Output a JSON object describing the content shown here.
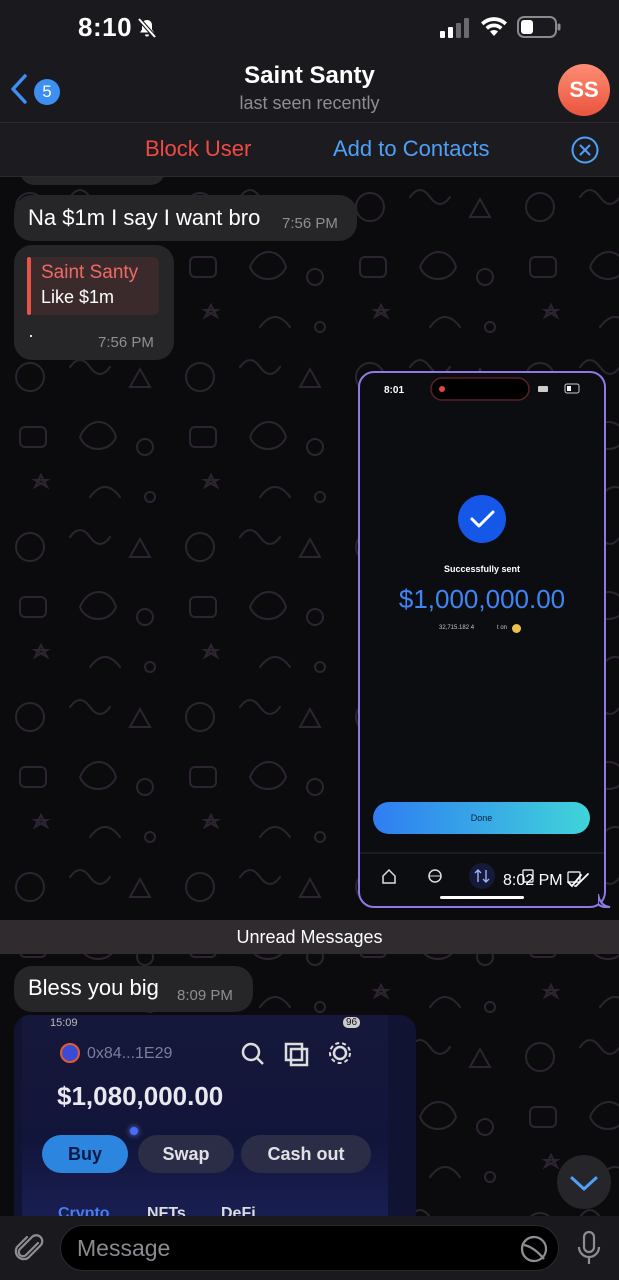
{
  "status_bar": {
    "time": "8:10",
    "icons": [
      "bell-slash-icon",
      "cellular-signal-icon",
      "wifi-icon",
      "battery-icon"
    ]
  },
  "header": {
    "back_badge_count": "5",
    "title": "Saint Santy",
    "subtitle": "last seen recently",
    "avatar_initials": "SS",
    "avatar_color": "#f06a50"
  },
  "action_bar": {
    "block_label": "Block User",
    "add_label": "Add to Contacts",
    "block_color": "#ef4a44",
    "add_color": "#4fa0f7"
  },
  "messages": [
    {
      "text": "Na $1m I say I want bro",
      "time": "7:56 PM"
    },
    {
      "reply_name": "Saint Santy",
      "reply_text": "Like $1m",
      "text": "·",
      "time": "7:56 PM"
    },
    {
      "type": "image",
      "time": "8:02 PM",
      "screenshot": {
        "time": "8:01",
        "status": "Successfully sent",
        "amount": "$1,000,000.00",
        "detail_amount": "32,715.182 4",
        "detail_on": "t on",
        "done_label": "Done"
      }
    },
    {
      "text": "Bless you big",
      "time": "8:09 PM"
    },
    {
      "type": "image",
      "photo": {
        "time": "15:09",
        "address": "0x84...1E29",
        "battery": "96",
        "balance": "$1,080,000.00",
        "buttons": [
          "Buy",
          "Swap",
          "Cash out"
        ],
        "tabs": [
          "Crypto",
          "NFTs",
          "DeFi"
        ]
      }
    }
  ],
  "unread_label": "Unread Messages",
  "composer": {
    "placeholder": "Message"
  }
}
